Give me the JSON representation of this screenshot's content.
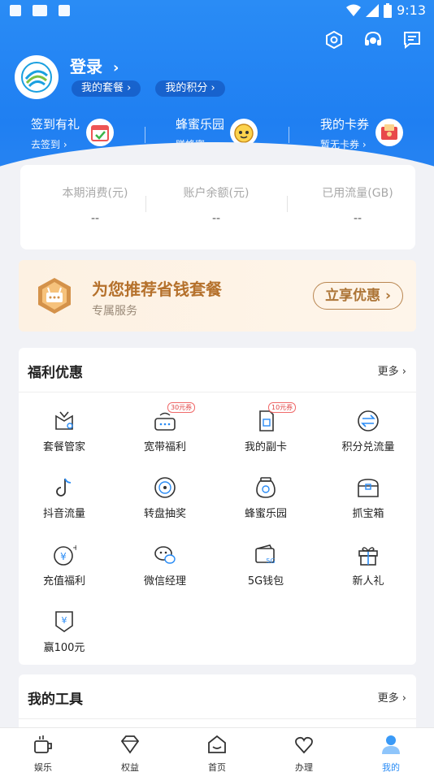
{
  "status_bar": {
    "time": "9:13"
  },
  "header": {
    "login_label": "登录",
    "pills": [
      {
        "label": "我的套餐"
      },
      {
        "label": "我的积分"
      }
    ],
    "quick": [
      {
        "title": "签到有礼",
        "sub": "去签到"
      },
      {
        "title": "蜂蜜乐园",
        "sub": "赚蜂蜜"
      },
      {
        "title": "我的卡券",
        "sub": "暂无卡券"
      }
    ]
  },
  "stats": [
    {
      "label": "本期消费(元)",
      "value": "--"
    },
    {
      "label": "账户余额(元)",
      "value": "--"
    },
    {
      "label": "已用流量(GB)",
      "value": "--"
    }
  ],
  "recommend": {
    "title": "为您推荐省钱套餐",
    "subtitle": "专属服务",
    "button": "立享优惠"
  },
  "welfare": {
    "title": "福利优惠",
    "more": "更多",
    "items": [
      {
        "label": "套餐管家",
        "icon": "package-gift-icon"
      },
      {
        "label": "宽带福利",
        "icon": "router-icon",
        "badge": "30元券"
      },
      {
        "label": "我的副卡",
        "icon": "sim-card-icon",
        "badge": "10元券"
      },
      {
        "label": "积分兑流量",
        "icon": "exchange-icon"
      },
      {
        "label": "抖音流量",
        "icon": "tiktok-icon"
      },
      {
        "label": "转盘抽奖",
        "icon": "spin-wheel-icon"
      },
      {
        "label": "蜂蜜乐园",
        "icon": "honey-jar-icon"
      },
      {
        "label": "抓宝箱",
        "icon": "treasure-box-icon"
      },
      {
        "label": "充值福利",
        "icon": "yuan-coin-icon"
      },
      {
        "label": "微信经理",
        "icon": "wechat-icon"
      },
      {
        "label": "5G钱包",
        "icon": "wallet-icon"
      },
      {
        "label": "新人礼",
        "icon": "gift-box-icon"
      },
      {
        "label": "赢100元",
        "icon": "yuan-badge-icon"
      }
    ]
  },
  "tools": {
    "title": "我的工具",
    "more": "更多"
  },
  "bottom_nav": [
    {
      "label": "娱乐"
    },
    {
      "label": "权益"
    },
    {
      "label": "首页"
    },
    {
      "label": "办理"
    },
    {
      "label": "我的",
      "active": true
    }
  ],
  "colors": {
    "brand_blue": "#2a8cf5",
    "gold": "#b5712c"
  }
}
